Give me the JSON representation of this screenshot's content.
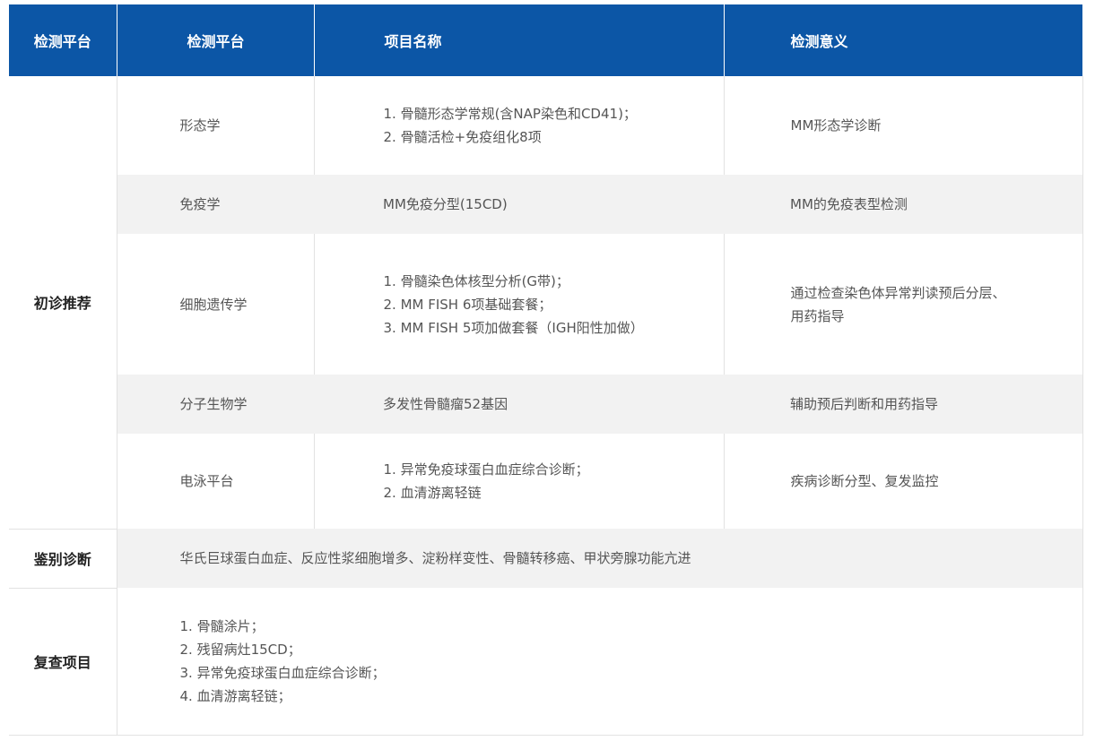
{
  "header": {
    "col0": "检测平台",
    "col1": "检测平台",
    "col2": "项目名称",
    "col3": "检测意义"
  },
  "initial": {
    "category": "初诊推荐",
    "rows": [
      {
        "platform": "形态学",
        "items": [
          "1. 骨髓形态学常规(含NAP染色和CD41)；",
          "2. 骨髓活检+免疫组化8项"
        ],
        "significance": [
          "MM形态学诊断"
        ]
      },
      {
        "platform": "免疫学",
        "items": [
          "MM免疫分型(15CD)"
        ],
        "significance": [
          "MM的免疫表型检测"
        ]
      },
      {
        "platform": "细胞遗传学",
        "items": [
          "1. 骨髓染色体核型分析(G带)；",
          "2. MM FISH 6项基础套餐；",
          "3. MM FISH 5项加做套餐（IGH阳性加做）"
        ],
        "significance": [
          "通过检查染色体异常判读预后分层、",
          "用药指导"
        ]
      },
      {
        "platform": "分子生物学",
        "items": [
          "多发性骨髓瘤52基因"
        ],
        "significance": [
          "辅助预后判断和用药指导"
        ]
      },
      {
        "platform": "电泳平台",
        "items": [
          "1. 异常免疫球蛋白血症综合诊断；",
          "2. 血清游离轻链"
        ],
        "significance": [
          "疾病诊断分型、复发监控"
        ]
      }
    ]
  },
  "differential": {
    "category": "鉴别诊断",
    "text": "华氏巨球蛋白血症、反应性浆细胞增多、淀粉样变性、骨髓转移癌、甲状旁腺功能亢进"
  },
  "recheck": {
    "category": "复查项目",
    "items": [
      "1. 骨髓涂片；",
      "2. 残留病灶15CD；",
      "3. 异常免疫球蛋白血症综合诊断；",
      "4. 血清游离轻链；"
    ]
  }
}
